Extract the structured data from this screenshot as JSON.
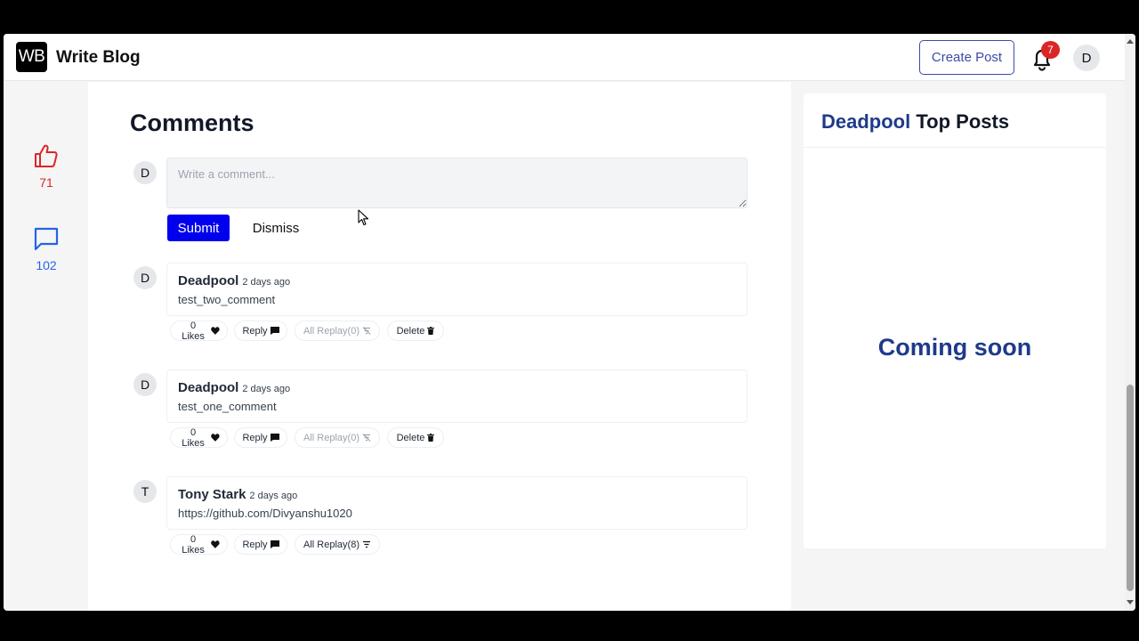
{
  "navbar": {
    "logo_text": "WB",
    "brand": "Write Blog",
    "create_post": "Create Post",
    "notification_count": "7",
    "user_initial": "D"
  },
  "reactions": {
    "likes": "71",
    "comments": "102",
    "like_color": "#dc2626",
    "comment_color": "#2563eb"
  },
  "comments": {
    "title": "Comments",
    "input_avatar": "D",
    "placeholder": "Write a comment...",
    "submit": "Submit",
    "dismiss": "Dismiss",
    "items": [
      {
        "avatar": "D",
        "author": "Deadpool",
        "time": "2 days ago",
        "text": "test_two_comment",
        "likes": "0 Likes",
        "reply": "Reply",
        "all_replay": "All Replay(0)",
        "delete": "Delete"
      },
      {
        "avatar": "D",
        "author": "Deadpool",
        "time": "2 days ago",
        "text": "test_one_comment",
        "likes": "0 Likes",
        "reply": "Reply",
        "all_replay": "All Replay(0)",
        "delete": "Delete"
      },
      {
        "avatar": "T",
        "author": "Tony Stark",
        "time": "2 days ago",
        "text": "https://github.com/Divyanshu1020",
        "likes": "0 Likes",
        "reply": "Reply",
        "all_replay": "All Replay(8)"
      }
    ]
  },
  "side": {
    "title_name": "Deadpool",
    "title_rest": " Top Posts",
    "coming_soon": "Coming soon"
  }
}
